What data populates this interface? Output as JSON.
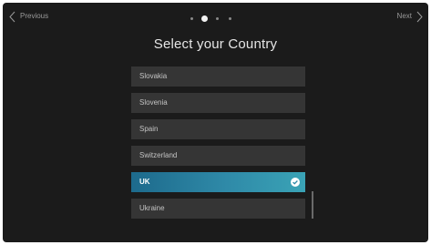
{
  "header": {
    "prev_label": "Previous",
    "next_label": "Next",
    "page_indicator": {
      "total": 4,
      "current": 2
    }
  },
  "title": "Select your Country",
  "countries": {
    "items": [
      {
        "label": "Slovakia"
      },
      {
        "label": "Slovenia"
      },
      {
        "label": "Spain"
      },
      {
        "label": "Switzerland"
      },
      {
        "label": "UK",
        "selected": true
      },
      {
        "label": "Ukraine"
      }
    ]
  },
  "icons": {
    "prev": "chevron-left-icon",
    "next": "chevron-right-icon",
    "selected": "check-circle-icon"
  },
  "colors": {
    "background": "#1b1b1b",
    "item": "#353535",
    "selected_start": "#1d6a8c",
    "selected_end": "#3aa3b6"
  }
}
